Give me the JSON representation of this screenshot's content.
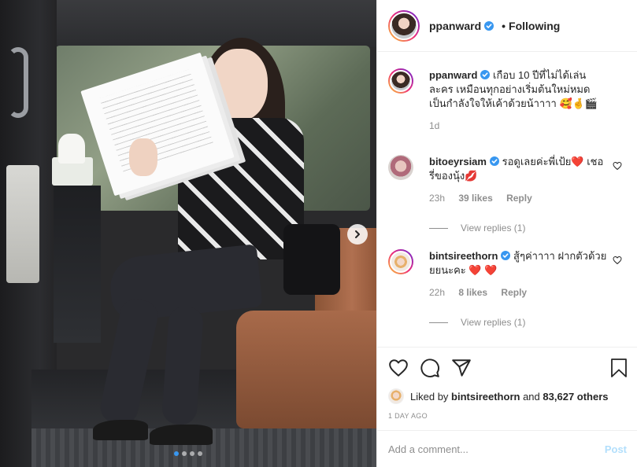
{
  "post": {
    "username": "ppanward",
    "follow_separator": "•",
    "follow_status": "Following"
  },
  "caption": {
    "username": "ppanward",
    "text": "เกือบ 10 ปีที่ไม่ได้เล่นละคร เหมือนทุกอย่างเริ่มต้นใหม่หมด เป็นกำลังใจให้เค้าด้วยน้าาาา 🥰🤞🎬",
    "age": "1d"
  },
  "comments": [
    {
      "username": "bitoeyrsiam",
      "text": "รอดูเลยค่ะพี่เป้ย❤️ เชอรี่ของนุ้ง💋",
      "age": "23h",
      "likes": "39 likes",
      "reply": "Reply",
      "view_replies": "View replies (1)"
    },
    {
      "username": "bintsireethorn",
      "text": "สู้ๆค่าาาา ฝากตัวด้วยยยนะคะ ❤️ ❤️",
      "age": "22h",
      "likes": "8 likes",
      "reply": "Reply",
      "view_replies": "View replies (1)"
    }
  ],
  "liked_by": {
    "prefix": "Liked by",
    "user": "bintsireethorn",
    "and_text": "and",
    "count": "83,627 others"
  },
  "timestamp": "1 DAY AGO",
  "composer": {
    "placeholder": "Add a comment...",
    "post_label": "Post"
  },
  "carousel": {
    "total": 4,
    "active_index": 0
  },
  "icons": {
    "verified": "verified-badge-icon",
    "like": "heart-icon",
    "comment": "comment-icon",
    "share": "paper-plane-icon",
    "save": "bookmark-icon",
    "next": "chevron-right-icon"
  },
  "colors": {
    "accent": "#3897f0",
    "verified": "#3897f0",
    "post_disabled": "#b2dffc",
    "secondary_text": "#8e8e8e"
  }
}
